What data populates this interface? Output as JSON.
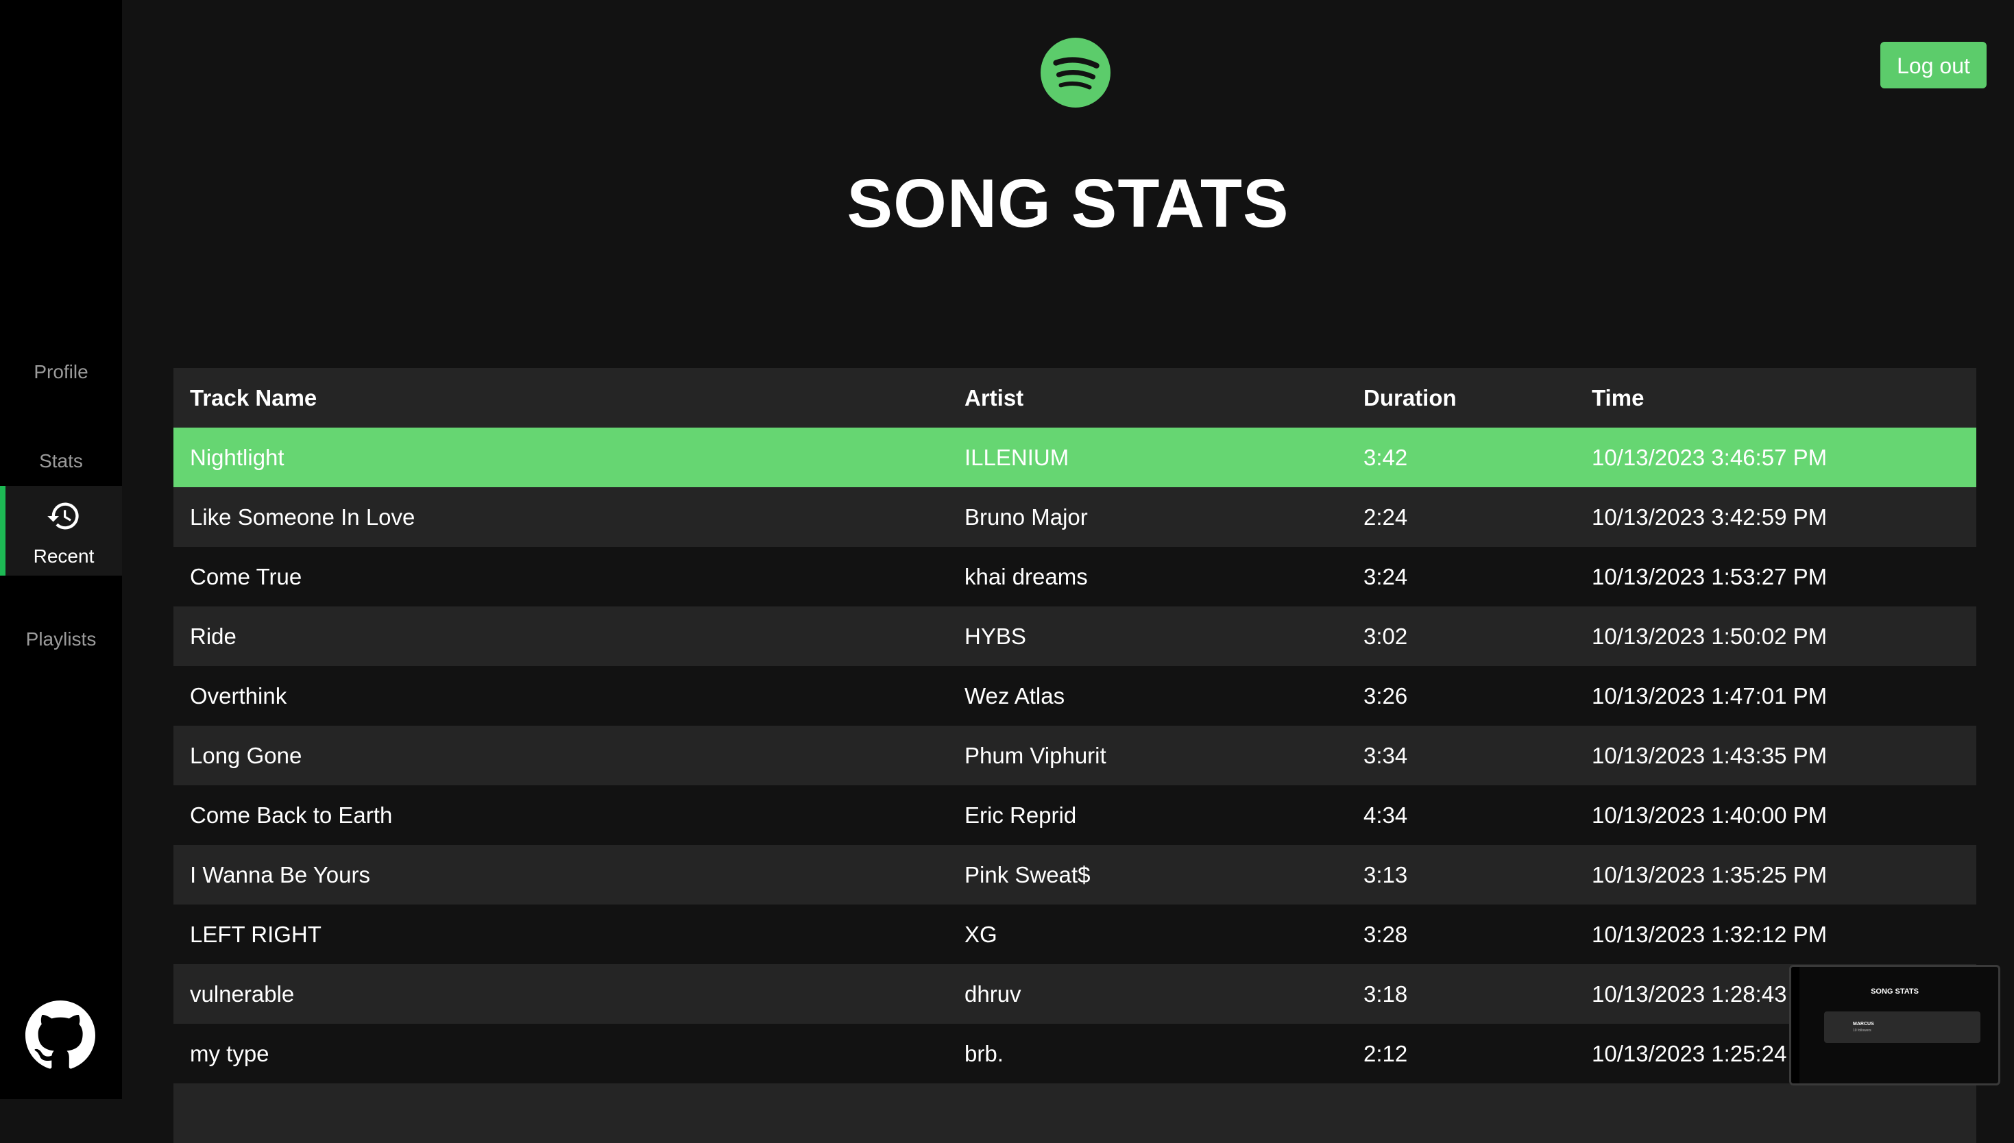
{
  "sidebar": {
    "items": [
      {
        "label": "Profile"
      },
      {
        "label": "Stats"
      },
      {
        "label": "Recent"
      },
      {
        "label": "Playlists"
      }
    ],
    "active": "Recent"
  },
  "header": {
    "title": "SONG STATS",
    "logout_label": "Log out"
  },
  "table": {
    "columns": [
      "Track Name",
      "Artist",
      "Duration",
      "Time"
    ],
    "rows": [
      {
        "track": "Nightlight",
        "artist": "ILLENIUM",
        "duration": "3:42",
        "time": "10/13/2023 3:46:57 PM"
      },
      {
        "track": "Like Someone In Love",
        "artist": "Bruno Major",
        "duration": "2:24",
        "time": "10/13/2023 3:42:59 PM"
      },
      {
        "track": "Come True",
        "artist": "khai dreams",
        "duration": "3:24",
        "time": "10/13/2023 1:53:27 PM"
      },
      {
        "track": "Ride",
        "artist": "HYBS",
        "duration": "3:02",
        "time": "10/13/2023 1:50:02 PM"
      },
      {
        "track": "Overthink",
        "artist": "Wez Atlas",
        "duration": "3:26",
        "time": "10/13/2023 1:47:01 PM"
      },
      {
        "track": "Long Gone",
        "artist": "Phum Viphurit",
        "duration": "3:34",
        "time": "10/13/2023 1:43:35 PM"
      },
      {
        "track": "Come Back to Earth",
        "artist": "Eric Reprid",
        "duration": "4:34",
        "time": "10/13/2023 1:40:00 PM"
      },
      {
        "track": "I Wanna Be Yours",
        "artist": "Pink Sweat$",
        "duration": "3:13",
        "time": "10/13/2023 1:35:25 PM"
      },
      {
        "track": "LEFT RIGHT",
        "artist": "XG",
        "duration": "3:28",
        "time": "10/13/2023 1:32:12 PM"
      },
      {
        "track": "vulnerable",
        "artist": "dhruv",
        "duration": "3:18",
        "time": "10/13/2023 1:28:43 PM"
      },
      {
        "track": "my type",
        "artist": "brb.",
        "duration": "2:12",
        "time": "10/13/2023 1:25:24 PM"
      }
    ]
  },
  "thumbnail": {
    "title": "SONG STATS",
    "name": "MARCUS",
    "followers": "10 followers"
  },
  "icons": {
    "logo": "spotify-logo-icon",
    "recent": "history-icon",
    "github": "github-icon"
  },
  "colors": {
    "accent": "#1db954",
    "highlight_row": "#66d672",
    "sidebar_bg": "#000000",
    "main_bg": "#121212",
    "row_alt_bg": "#252525"
  }
}
